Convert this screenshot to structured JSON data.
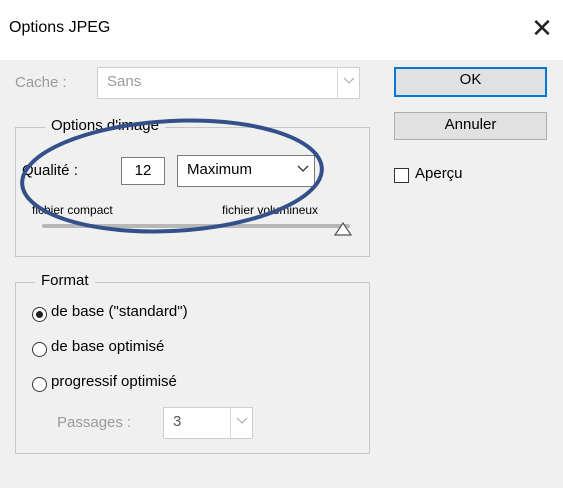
{
  "window": {
    "title": "Options JPEG",
    "close_symbol": "✕"
  },
  "cache": {
    "label": "Cache :",
    "value": "Sans"
  },
  "buttons": {
    "ok": "OK",
    "cancel": "Annuler"
  },
  "preview": {
    "label": "Aperçu",
    "checked": false
  },
  "image_options": {
    "legend": "Options d'image",
    "quality_label": "Qualité :",
    "quality_value": "12",
    "quality_preset": "Maximum",
    "slider_min_label": "fichier compact",
    "slider_max_label": "fichier volumineux",
    "slider_level": 1.0
  },
  "format": {
    "legend": "Format",
    "options": [
      {
        "label": "de base (\"standard\")",
        "selected": true
      },
      {
        "label": "de base optimisé",
        "selected": false
      },
      {
        "label": "progressif optimisé",
        "selected": false
      }
    ],
    "passes_label": "Passages :",
    "passes_value": "3"
  },
  "colors": {
    "annotation": "#34508a",
    "default_button_border": "#0078d7"
  }
}
